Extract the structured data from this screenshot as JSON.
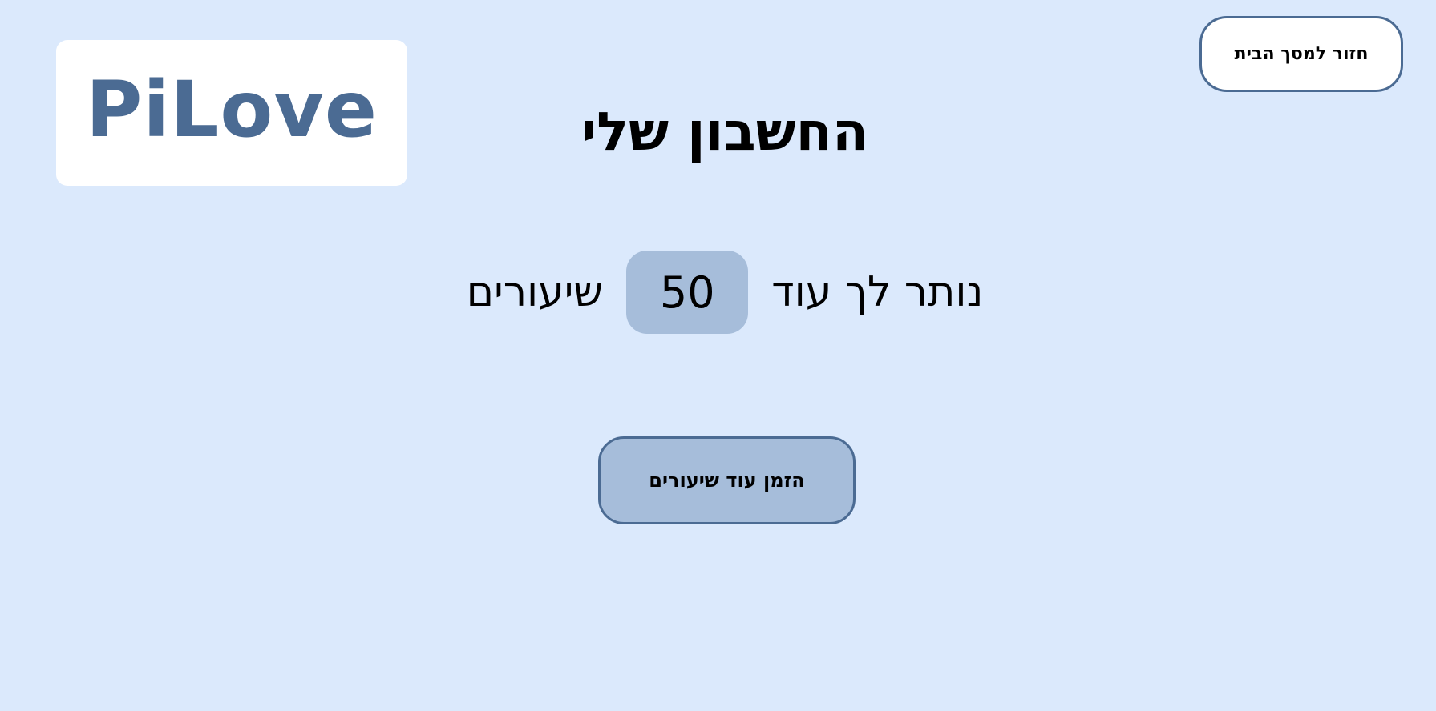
{
  "logo": {
    "text": "PiLove"
  },
  "header": {
    "home_button_label": "חזור למסך הבית"
  },
  "main": {
    "title": "החשבון שלי",
    "remaining_prefix": "נותר לך עוד",
    "remaining_count": "50",
    "remaining_suffix": "שיעורים",
    "order_button_label": "הזמן עוד שיעורים"
  },
  "colors": {
    "background": "#dbe9fc",
    "accent": "#4b6b93",
    "button_fill": "#a6bdda",
    "card": "#ffffff"
  }
}
